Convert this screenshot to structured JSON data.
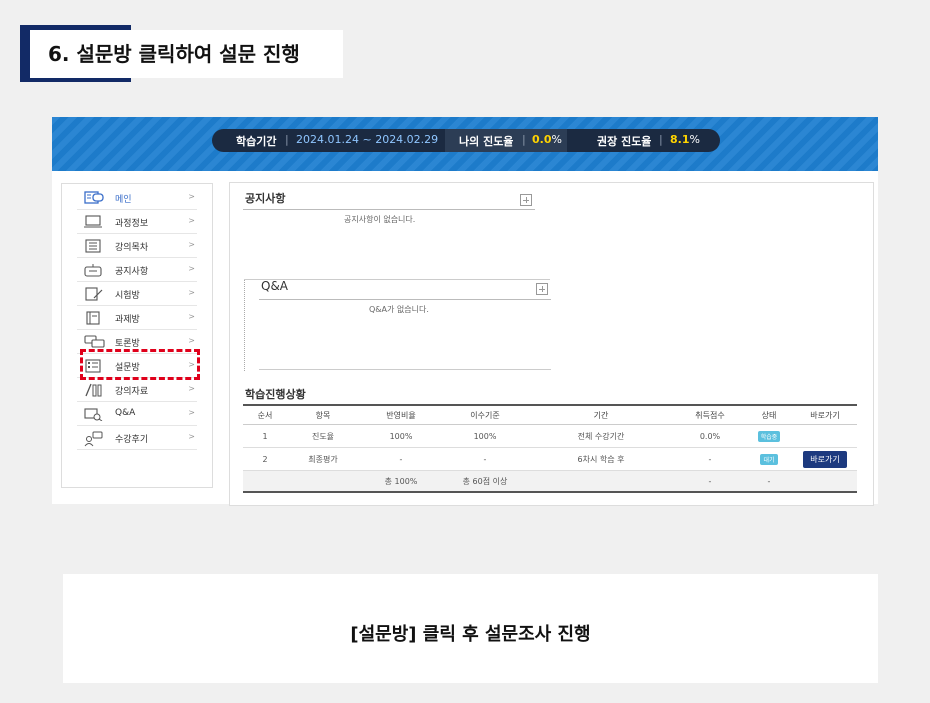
{
  "title": "6. 설문방 클릭하여 설문 진행",
  "banner": {
    "period_label": "학습기간",
    "period_value": "2024.01.24 ~ 2024.02.29",
    "my_progress_label": "나의 진도율",
    "my_progress_value": "0.0",
    "recommended_label": "권장 진도율",
    "recommended_value": "8.1",
    "percent_sign": "%",
    "separator": "|"
  },
  "sidebar": {
    "arrow": ">",
    "items": [
      {
        "label": "메인",
        "icon": "home-icon"
      },
      {
        "label": "과정정보",
        "icon": "monitor-icon"
      },
      {
        "label": "강의목차",
        "icon": "list-icon"
      },
      {
        "label": "공지사항",
        "icon": "notice-icon"
      },
      {
        "label": "시험방",
        "icon": "exam-icon"
      },
      {
        "label": "과제방",
        "icon": "assignment-icon"
      },
      {
        "label": "토론방",
        "icon": "discussion-icon"
      },
      {
        "label": "설문방",
        "icon": "survey-icon"
      },
      {
        "label": "강의자료",
        "icon": "materials-icon"
      },
      {
        "label": "Q&A",
        "icon": "qa-icon"
      },
      {
        "label": "수강후기",
        "icon": "review-icon"
      }
    ]
  },
  "notice": {
    "title": "공지사항",
    "empty": "공지사항이 없습니다."
  },
  "qa": {
    "title": "Q&A",
    "empty": "Q&A가 없습니다."
  },
  "progress": {
    "title": "학습진행상황",
    "headers": [
      "순서",
      "항목",
      "반영비율",
      "이수기준",
      "기간",
      "취득점수",
      "상태",
      "바로가기"
    ],
    "rows": [
      {
        "no": "1",
        "item": "진도율",
        "ratio": "100%",
        "criteria": "100%",
        "period": "전체 수강기간",
        "score": "0.0%",
        "status": "학습중",
        "action": ""
      },
      {
        "no": "2",
        "item": "최종평가",
        "ratio": "-",
        "criteria": "-",
        "period": "6차시 학습 후",
        "score": "-",
        "status": "대기",
        "action": "바로가기"
      }
    ],
    "summary": {
      "ratio": "총 100%",
      "criteria": "총 60점 이상",
      "score": "-",
      "status": "-"
    }
  },
  "caption": "[설문방] 클릭 후 설문조사 진행",
  "colors": {
    "accent": "#122a66",
    "banner": "#1e7fd0",
    "highlight": "#e0001b",
    "badge": "#5bc0de",
    "button": "#1d3a7f"
  }
}
